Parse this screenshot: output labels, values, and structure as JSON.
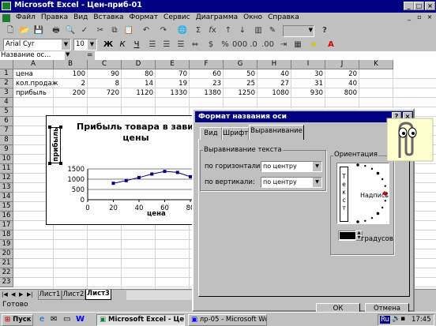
{
  "window": {
    "title": "Microsoft Excel - Цен-приб-01"
  },
  "menu": [
    "Файл",
    "Правка",
    "Вид",
    "Вставка",
    "Формат",
    "Сервис",
    "Диаграмма",
    "Окно",
    "Справка"
  ],
  "toolbar": {
    "font": "Arial Cyr",
    "size": "10",
    "zoom": "",
    "help_icon": "?"
  },
  "formula": {
    "name_box": "Название ос...",
    "eq": "="
  },
  "columns": [
    "A",
    "B",
    "C",
    "D",
    "E",
    "F",
    "G",
    "H",
    "I",
    "J",
    "K"
  ],
  "rows": [
    "1",
    "2",
    "3",
    "4",
    "5",
    "6",
    "7",
    "8",
    "9",
    "10",
    "11",
    "12",
    "13",
    "14",
    "15",
    "16",
    "17",
    "18",
    "19",
    "20",
    "21",
    "22",
    "23"
  ],
  "table": [
    {
      "label": "цена",
      "values": [
        "100",
        "90",
        "80",
        "70",
        "60",
        "50",
        "40",
        "30",
        "20"
      ]
    },
    {
      "label": "кол.продаж",
      "values": [
        "2",
        "8",
        "14",
        "19",
        "23",
        "25",
        "27",
        "31",
        "40"
      ]
    },
    {
      "label": "прибыль",
      "values": [
        "200",
        "720",
        "1120",
        "1330",
        "1380",
        "1250",
        "1080",
        "930",
        "800"
      ]
    }
  ],
  "chart_data": {
    "type": "line",
    "title": "Прибыль товара в зависи",
    "title_line2": "цены",
    "ylabel": "прибыль",
    "xlabel": "цена",
    "x_ticks": [
      "0",
      "20",
      "40",
      "60",
      "80"
    ],
    "y_ticks": [
      "1500",
      "1000",
      "500",
      "0"
    ],
    "xlim": [
      0,
      80
    ],
    "ylim": [
      0,
      1500
    ],
    "series": [
      {
        "x": [
          20,
          30,
          40,
          50,
          60,
          70,
          80
        ],
        "y": [
          800,
          930,
          1080,
          1250,
          1380,
          1330,
          1120
        ]
      }
    ]
  },
  "sheets": [
    "Лист1",
    "Лист2",
    "Лист3"
  ],
  "status": "Готово",
  "dialog": {
    "title": "Формат названия оси",
    "tabs": [
      "Вид",
      "Шрифт",
      "Выравнивание"
    ],
    "align_group": "Выравнивание текста",
    "h_label": "по горизонтали:",
    "h_value": "по центру",
    "v_label": "по вертикали:",
    "v_value": "по центру",
    "orient_group": "Ориентация",
    "vertical_text": "Текст",
    "orient_label": "Надпись",
    "degrees_value": "90",
    "degrees_label": "градусов",
    "ok": "ОК",
    "cancel": "Отмена"
  },
  "taskbar": {
    "start": "Пуск",
    "items": [
      "Microsoft Excel - Цен...",
      "лр-05 - Microsoft Word"
    ],
    "lang": "Ru",
    "time": "17:45"
  }
}
